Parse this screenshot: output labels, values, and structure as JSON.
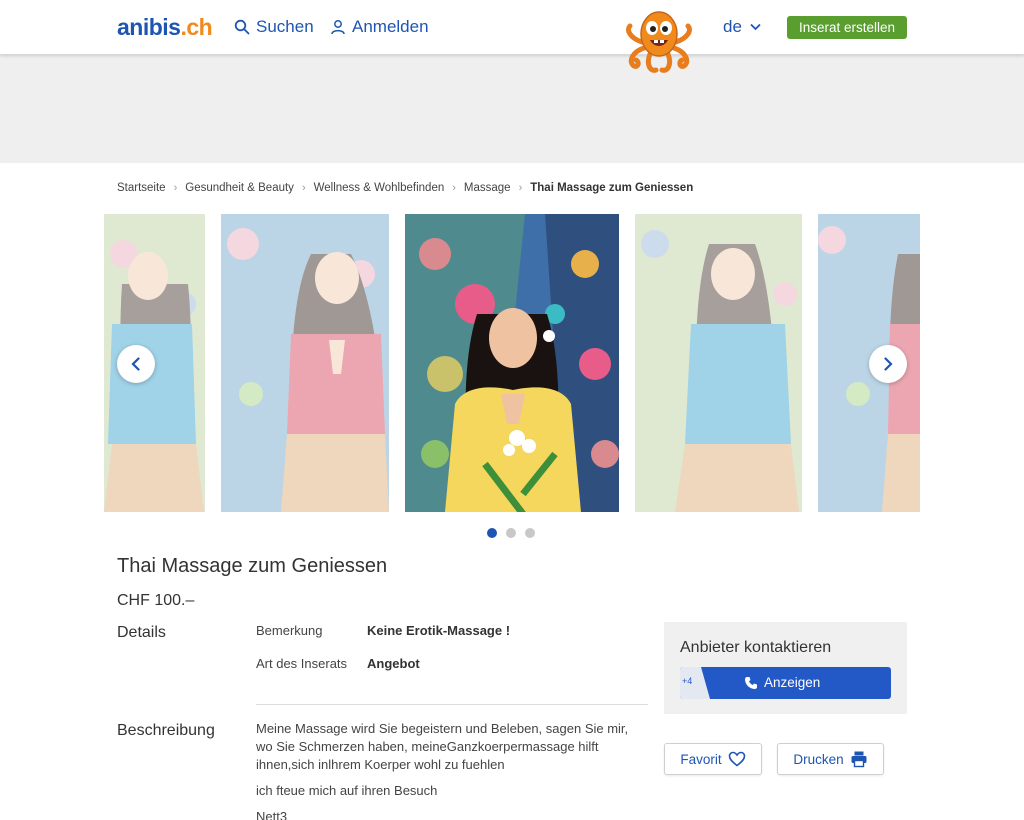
{
  "header": {
    "logo_main": "anibis",
    "logo_tld": ".ch",
    "search_label": "Suchen",
    "login_label": "Anmelden",
    "language": "de",
    "create_label": "Inserat erstellen"
  },
  "breadcrumb": {
    "items": [
      "Startseite",
      "Gesundheit & Beauty",
      "Wellness & Wohlbefinden",
      "Massage"
    ],
    "current": "Thai Massage zum Geniessen"
  },
  "gallery": {
    "active_index": 0,
    "dot_count": 3
  },
  "listing": {
    "title": "Thai Massage zum Geniessen",
    "price": "CHF 100.–",
    "details_label": "Details",
    "details": [
      {
        "key": "Bemerkung",
        "value": "Keine Erotik-Massage !"
      },
      {
        "key": "Art des Inserats",
        "value": "Angebot"
      }
    ],
    "description_label": "Beschreibung",
    "description": [
      "Meine Massage wird Sie begeistern und Beleben, sagen Sie mir, wo Sie Schmerzen haben, meineGanzkoerpermassage hilft ihnen,sich inlhrem Koerper wohl zu fuehlen",
      "ich fteue mich auf ihren Besuch",
      "Nett3"
    ]
  },
  "contact": {
    "title": "Anbieter kontaktieren",
    "phone_peek": "+4",
    "reveal_label": "Anzeigen"
  },
  "actions": {
    "favorite_label": "Favorit",
    "print_label": "Drucken"
  },
  "colors": {
    "brand_blue": "#1e55b3",
    "brand_orange": "#f08a1c",
    "create_green": "#5a9e30",
    "cta_blue": "#2358c7"
  }
}
